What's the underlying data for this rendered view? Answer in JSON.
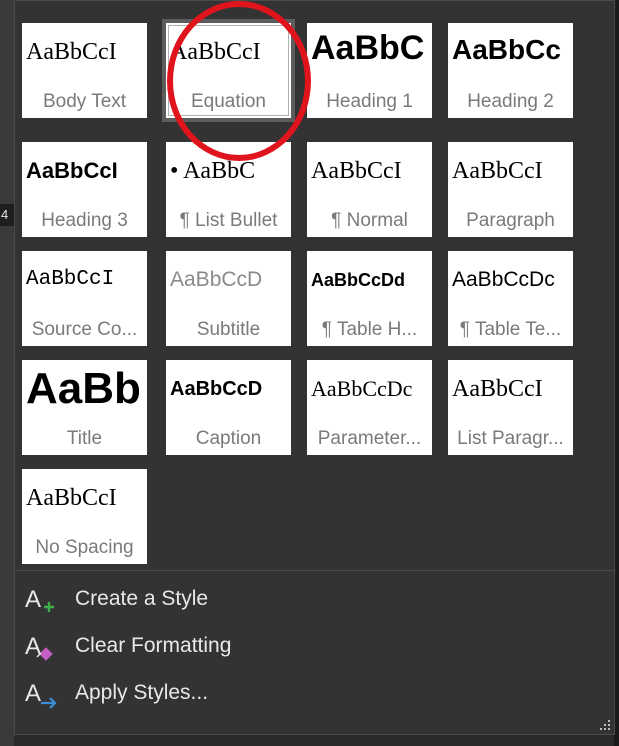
{
  "left_marker": "4",
  "styles": [
    {
      "preview": "AaBbCcI",
      "label": "Body Text",
      "selected": false
    },
    {
      "preview": "AaBbCcI",
      "label": "Equation",
      "selected": true
    },
    {
      "preview": "AaBbC",
      "label": "Heading 1",
      "selected": false
    },
    {
      "preview": "AaBbCc",
      "label": "Heading 2",
      "selected": false
    },
    {
      "preview": "AaBbCcI",
      "label": "Heading 3",
      "selected": false
    },
    {
      "preview": "• AaBbC",
      "label": "¶ List Bullet",
      "selected": false
    },
    {
      "preview": "AaBbCcI",
      "label": "¶ Normal",
      "selected": false
    },
    {
      "preview": "AaBbCcI",
      "label": "Paragraph",
      "selected": false
    },
    {
      "preview": "AaBbCcI",
      "label": "Source Co...",
      "selected": false
    },
    {
      "preview": "AaBbCcD",
      "label": "Subtitle",
      "selected": false
    },
    {
      "preview": "AaBbCcDd",
      "label": "¶ Table H...",
      "selected": false
    },
    {
      "preview": "AaBbCcDc",
      "label": "¶ Table Te...",
      "selected": false
    },
    {
      "preview": "AaBb",
      "label": "Title",
      "selected": false
    },
    {
      "preview": "AaBbCcD",
      "label": "Caption",
      "selected": false
    },
    {
      "preview": "AaBbCcDc",
      "label": "Parameter...",
      "selected": false
    },
    {
      "preview": "AaBbCcI",
      "label": "List Paragr...",
      "selected": false
    },
    {
      "preview": "AaBbCcI",
      "label": "No Spacing",
      "selected": false
    }
  ],
  "menu": {
    "create_style": "Create a Style",
    "clear_formatting": "Clear Formatting",
    "apply_styles": "Apply Styles..."
  },
  "colors": {
    "panel_bg": "#333333",
    "highlight_circle": "#e0141c",
    "create_icon_accent": "#3fae49",
    "clear_icon_accent": "#c45fc4",
    "apply_icon_accent": "#3b8fd6"
  }
}
